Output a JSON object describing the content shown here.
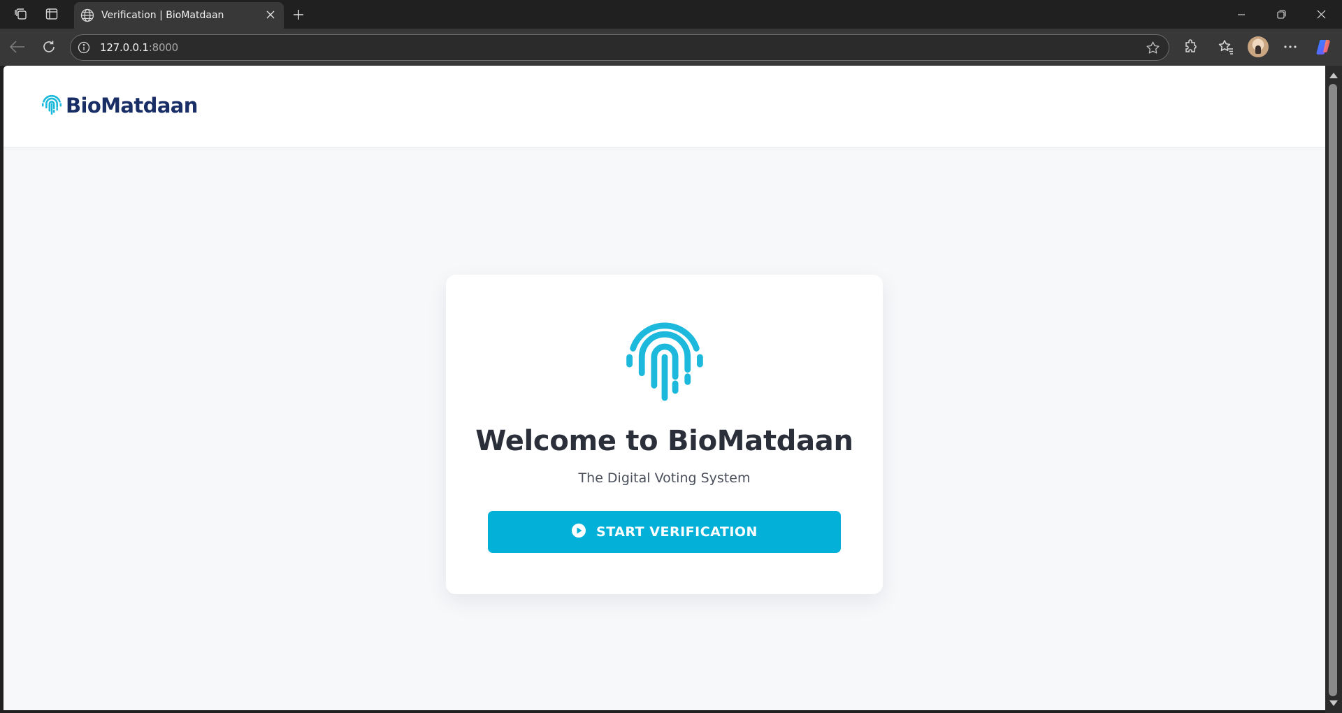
{
  "browser": {
    "tab_title": "Verification | BioMatdaan",
    "url_host": "127.0.0.1",
    "url_port": ":8000"
  },
  "site": {
    "brand_name": "BioMatdaan",
    "brand_color": "#1a2e66",
    "accent_color": "#03b1d8"
  },
  "card": {
    "icon": "fingerprint-icon",
    "title": "Welcome to BioMatdaan",
    "subtitle": "The Digital Voting System",
    "button_label": "START VERIFICATION",
    "button_icon": "play-circle-icon"
  }
}
